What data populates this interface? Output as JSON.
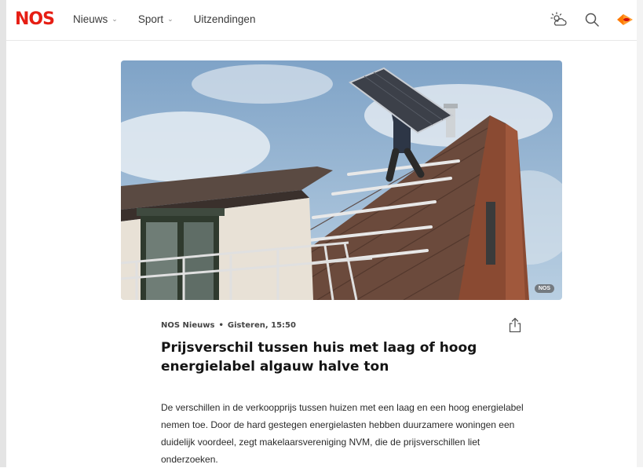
{
  "header": {
    "logo": "NOS",
    "nav": [
      {
        "label": "Nieuws",
        "has_dropdown": true
      },
      {
        "label": "Sport",
        "has_dropdown": true
      },
      {
        "label": "Uitzendingen",
        "has_dropdown": false
      }
    ],
    "icons": [
      "weather-icon",
      "search-icon",
      "npo-icon"
    ]
  },
  "hero": {
    "badge": "NOS"
  },
  "article": {
    "source": "NOS Nieuws",
    "separator": "•",
    "timestamp": "Gisteren, 15:50",
    "title": "Prijsverschil tussen huis met laag of hoog energielabel algauw halve ton",
    "lead": "De verschillen in de verkoopprijs tussen huizen met een laag en een hoog energielabel nemen toe. Door de hard gestegen energielasten hebben duurzamere woningen een duidelijk voordeel, zegt makelaarsvereniging NVM, die de prijsverschillen liet onderzoeken."
  },
  "colors": {
    "brand": "#e61e14",
    "npo": "#ff7a00"
  }
}
